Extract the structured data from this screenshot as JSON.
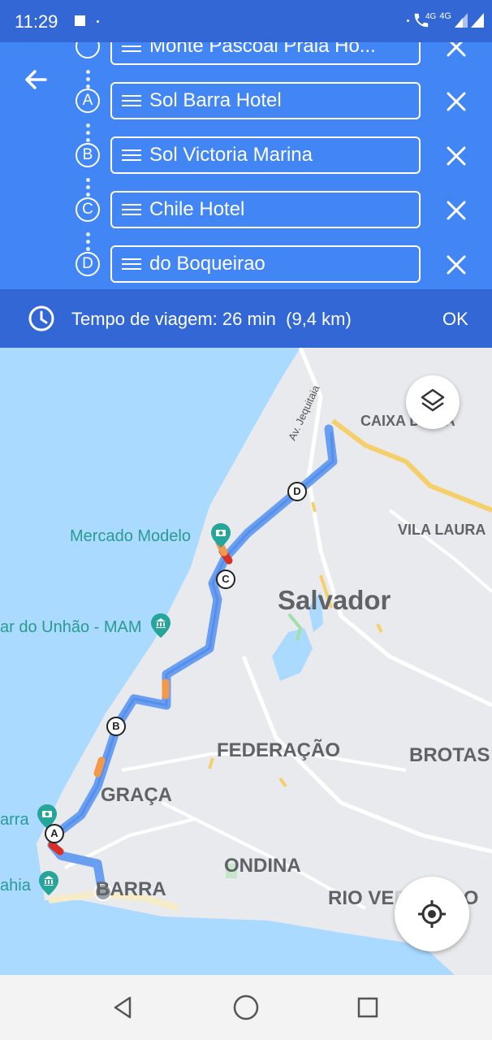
{
  "status": {
    "time": "11:29",
    "network1": "4G",
    "network2": "4G"
  },
  "stops": [
    {
      "marker": "",
      "text": "Monte Pascoal Praia Ho..."
    },
    {
      "marker": "A",
      "text": "Sol Barra Hotel"
    },
    {
      "marker": "B",
      "text": "Sol Victoria Marina"
    },
    {
      "marker": "C",
      "text": "Chile Hotel"
    },
    {
      "marker": "D",
      "text": "do Boqueirao"
    }
  ],
  "travel": {
    "text": "Tempo de viagem: 26 min  (9,4 km)",
    "ok_label": "OK"
  },
  "map": {
    "labels": {
      "caixa": "CAIXA D",
      "caixa_suffix": "UA",
      "vila_laura": "VILA LAURA",
      "salvador": "Salvador",
      "federacao": "FEDERAÇÃO",
      "brotas": "BROTAS",
      "graca": "GRAÇA",
      "ondina": "ONDINA",
      "barra": "BARRA",
      "rio_vermelho": "RIO VE",
      "rio_vermelho_suffix": "O",
      "mercado_modelo": "Mercado Modelo",
      "mam": "ar do Unhão - MAM",
      "barra_poi": "arra",
      "bahia_poi": "ahia",
      "street": "Av. Jequitaia"
    },
    "route_markers": [
      "A",
      "B",
      "C",
      "D"
    ],
    "colors": {
      "route": "#6a9ef0",
      "water": "#aadaff",
      "land": "#e8eaed",
      "header": "#4285f4"
    }
  }
}
